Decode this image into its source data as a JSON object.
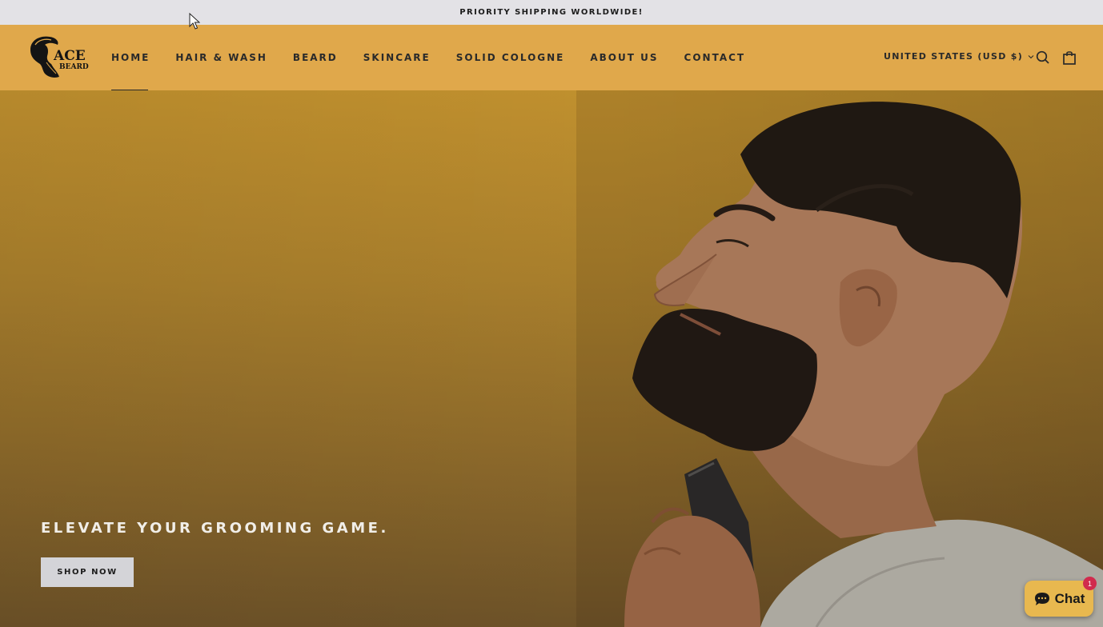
{
  "announcement": {
    "text": "PRIORITY SHIPPING WORLDWIDE!"
  },
  "header": {
    "logo": {
      "line1": "ACE",
      "line2": "BEARD"
    },
    "nav": [
      {
        "label": "HOME",
        "active": true
      },
      {
        "label": "HAIR & WASH"
      },
      {
        "label": "BEARD"
      },
      {
        "label": "SKINCARE"
      },
      {
        "label": "SOLID COLOGNE"
      },
      {
        "label": "ABOUT US"
      },
      {
        "label": "CONTACT"
      }
    ],
    "locale": "UNITED STATES (USD $)",
    "icons": {
      "search": "search-icon",
      "cart": "shopping-bag-icon",
      "locale": "chevron-down-icon"
    }
  },
  "hero": {
    "title": "ELEVATE YOUR GROOMING GAME.",
    "cta": "SHOP NOW",
    "image": "man-trimming-beard-photo"
  },
  "chat": {
    "label": "Chat",
    "badge": "1",
    "icon": "chat-bubble-icon"
  },
  "colors": {
    "announcement_bg": "#e3e2e6",
    "header_bg": "#e0a84b",
    "hero_bg": "#b8892c",
    "button_bg": "#d4d4d8",
    "chat_bg": "#e8b84f",
    "badge_bg": "#d12b4d",
    "text_dark": "#2a2a2a"
  }
}
